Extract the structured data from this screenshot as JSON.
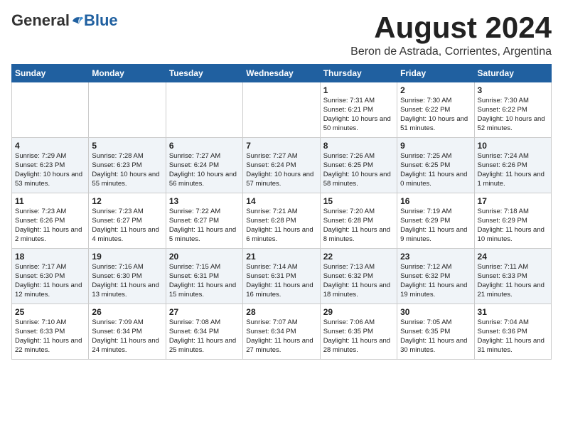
{
  "header": {
    "logo_general": "General",
    "logo_blue": "Blue",
    "month_title": "August 2024",
    "subtitle": "Beron de Astrada, Corrientes, Argentina"
  },
  "days_of_week": [
    "Sunday",
    "Monday",
    "Tuesday",
    "Wednesday",
    "Thursday",
    "Friday",
    "Saturday"
  ],
  "weeks": [
    [
      {
        "day": "",
        "info": ""
      },
      {
        "day": "",
        "info": ""
      },
      {
        "day": "",
        "info": ""
      },
      {
        "day": "",
        "info": ""
      },
      {
        "day": "1",
        "info": "Sunrise: 7:31 AM\nSunset: 6:21 PM\nDaylight: 10 hours and 50 minutes."
      },
      {
        "day": "2",
        "info": "Sunrise: 7:30 AM\nSunset: 6:22 PM\nDaylight: 10 hours and 51 minutes."
      },
      {
        "day": "3",
        "info": "Sunrise: 7:30 AM\nSunset: 6:22 PM\nDaylight: 10 hours and 52 minutes."
      }
    ],
    [
      {
        "day": "4",
        "info": "Sunrise: 7:29 AM\nSunset: 6:23 PM\nDaylight: 10 hours and 53 minutes."
      },
      {
        "day": "5",
        "info": "Sunrise: 7:28 AM\nSunset: 6:23 PM\nDaylight: 10 hours and 55 minutes."
      },
      {
        "day": "6",
        "info": "Sunrise: 7:27 AM\nSunset: 6:24 PM\nDaylight: 10 hours and 56 minutes."
      },
      {
        "day": "7",
        "info": "Sunrise: 7:27 AM\nSunset: 6:24 PM\nDaylight: 10 hours and 57 minutes."
      },
      {
        "day": "8",
        "info": "Sunrise: 7:26 AM\nSunset: 6:25 PM\nDaylight: 10 hours and 58 minutes."
      },
      {
        "day": "9",
        "info": "Sunrise: 7:25 AM\nSunset: 6:25 PM\nDaylight: 11 hours and 0 minutes."
      },
      {
        "day": "10",
        "info": "Sunrise: 7:24 AM\nSunset: 6:26 PM\nDaylight: 11 hours and 1 minute."
      }
    ],
    [
      {
        "day": "11",
        "info": "Sunrise: 7:23 AM\nSunset: 6:26 PM\nDaylight: 11 hours and 2 minutes."
      },
      {
        "day": "12",
        "info": "Sunrise: 7:23 AM\nSunset: 6:27 PM\nDaylight: 11 hours and 4 minutes."
      },
      {
        "day": "13",
        "info": "Sunrise: 7:22 AM\nSunset: 6:27 PM\nDaylight: 11 hours and 5 minutes."
      },
      {
        "day": "14",
        "info": "Sunrise: 7:21 AM\nSunset: 6:28 PM\nDaylight: 11 hours and 6 minutes."
      },
      {
        "day": "15",
        "info": "Sunrise: 7:20 AM\nSunset: 6:28 PM\nDaylight: 11 hours and 8 minutes."
      },
      {
        "day": "16",
        "info": "Sunrise: 7:19 AM\nSunset: 6:29 PM\nDaylight: 11 hours and 9 minutes."
      },
      {
        "day": "17",
        "info": "Sunrise: 7:18 AM\nSunset: 6:29 PM\nDaylight: 11 hours and 10 minutes."
      }
    ],
    [
      {
        "day": "18",
        "info": "Sunrise: 7:17 AM\nSunset: 6:30 PM\nDaylight: 11 hours and 12 minutes."
      },
      {
        "day": "19",
        "info": "Sunrise: 7:16 AM\nSunset: 6:30 PM\nDaylight: 11 hours and 13 minutes."
      },
      {
        "day": "20",
        "info": "Sunrise: 7:15 AM\nSunset: 6:31 PM\nDaylight: 11 hours and 15 minutes."
      },
      {
        "day": "21",
        "info": "Sunrise: 7:14 AM\nSunset: 6:31 PM\nDaylight: 11 hours and 16 minutes."
      },
      {
        "day": "22",
        "info": "Sunrise: 7:13 AM\nSunset: 6:32 PM\nDaylight: 11 hours and 18 minutes."
      },
      {
        "day": "23",
        "info": "Sunrise: 7:12 AM\nSunset: 6:32 PM\nDaylight: 11 hours and 19 minutes."
      },
      {
        "day": "24",
        "info": "Sunrise: 7:11 AM\nSunset: 6:33 PM\nDaylight: 11 hours and 21 minutes."
      }
    ],
    [
      {
        "day": "25",
        "info": "Sunrise: 7:10 AM\nSunset: 6:33 PM\nDaylight: 11 hours and 22 minutes."
      },
      {
        "day": "26",
        "info": "Sunrise: 7:09 AM\nSunset: 6:34 PM\nDaylight: 11 hours and 24 minutes."
      },
      {
        "day": "27",
        "info": "Sunrise: 7:08 AM\nSunset: 6:34 PM\nDaylight: 11 hours and 25 minutes."
      },
      {
        "day": "28",
        "info": "Sunrise: 7:07 AM\nSunset: 6:34 PM\nDaylight: 11 hours and 27 minutes."
      },
      {
        "day": "29",
        "info": "Sunrise: 7:06 AM\nSunset: 6:35 PM\nDaylight: 11 hours and 28 minutes."
      },
      {
        "day": "30",
        "info": "Sunrise: 7:05 AM\nSunset: 6:35 PM\nDaylight: 11 hours and 30 minutes."
      },
      {
        "day": "31",
        "info": "Sunrise: 7:04 AM\nSunset: 6:36 PM\nDaylight: 11 hours and 31 minutes."
      }
    ]
  ]
}
